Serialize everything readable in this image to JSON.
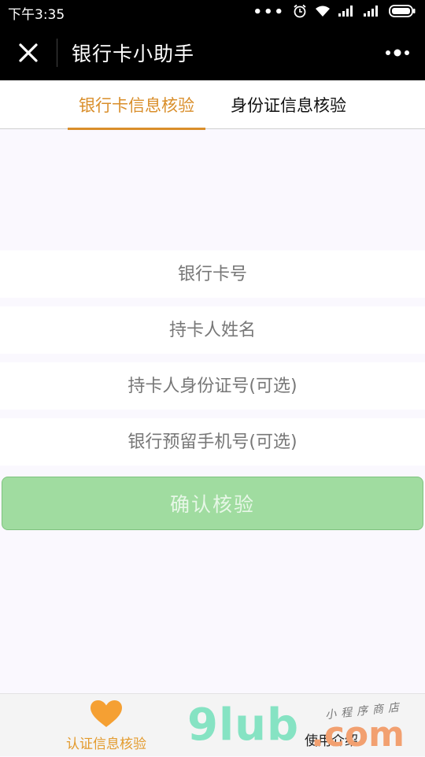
{
  "status_bar": {
    "time": "下午3:35",
    "dots": "•••"
  },
  "nav": {
    "title": "银行卡小助手"
  },
  "tabs": [
    {
      "label": "银行卡信息核验",
      "active": true
    },
    {
      "label": "身份证信息核验",
      "active": false
    }
  ],
  "form": {
    "card_number_placeholder": "银行卡号",
    "holder_name_placeholder": "持卡人姓名",
    "id_number_placeholder": "持卡人身份证号(可选)",
    "phone_placeholder": "银行预留手机号(可选)",
    "confirm_label": "确认核验"
  },
  "bottom_tabs": {
    "left_label": "认证信息核验",
    "left_icon": "heart-icon",
    "right_label": "使用介绍"
  },
  "watermark": {
    "brand": "9lub",
    "domain": ".com",
    "store": "小程序商店"
  },
  "colors": {
    "accent": "#D98E2A",
    "button": "#A0DCA0",
    "bar": "#000000",
    "background": "#FAF8FE"
  }
}
